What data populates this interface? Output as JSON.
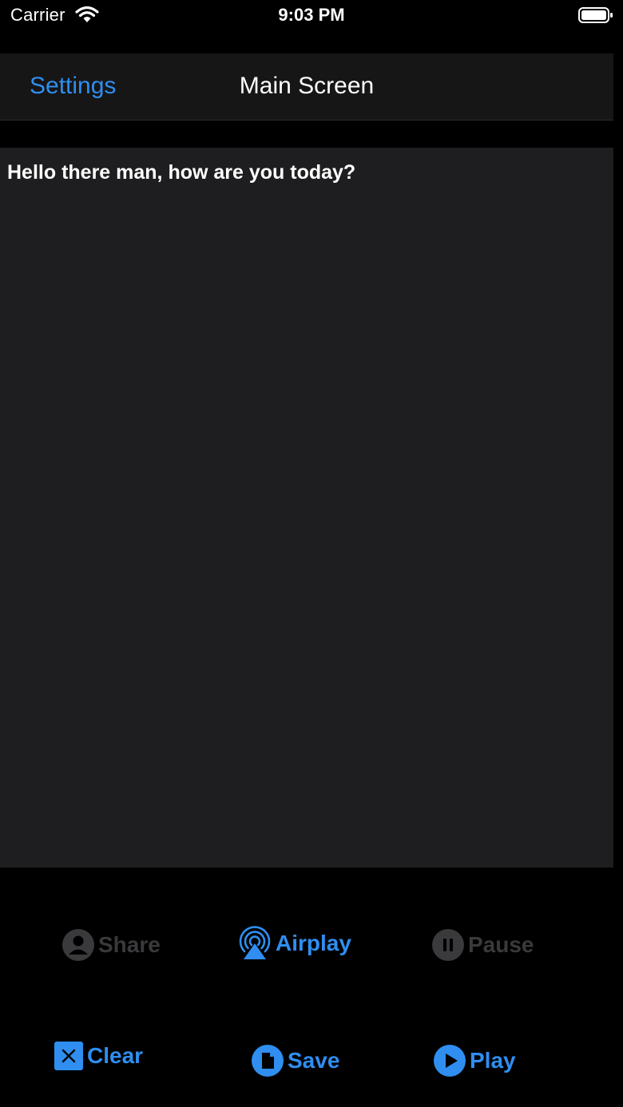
{
  "status_bar": {
    "carrier": "Carrier",
    "time": "9:03 PM"
  },
  "nav": {
    "back_label": "Settings",
    "title": "Main Screen"
  },
  "editor": {
    "text": "Hello there man, how are you today?"
  },
  "controls": {
    "share": {
      "label": "Share",
      "icon": "person-circle-icon",
      "enabled": false
    },
    "airplay": {
      "label": "Airplay",
      "icon": "airplay-icon",
      "enabled": true
    },
    "pause": {
      "label": "Pause",
      "icon": "pause-circle-icon",
      "enabled": false
    },
    "clear": {
      "label": "Clear",
      "icon": "clear-square-icon",
      "enabled": true
    },
    "save": {
      "label": "Save",
      "icon": "document-circle-icon",
      "enabled": true
    },
    "play": {
      "label": "Play",
      "icon": "play-circle-icon",
      "enabled": true
    }
  },
  "colors": {
    "accent": "#2f8ef0",
    "disabled": "#3a3a3c",
    "editor_bg": "#1e1e20",
    "nav_bg": "#161616",
    "background": "#000000"
  }
}
